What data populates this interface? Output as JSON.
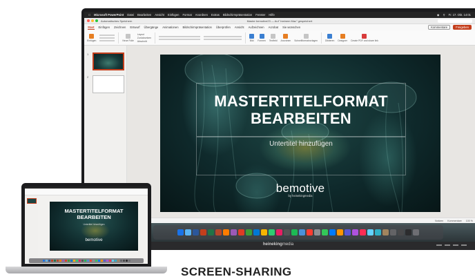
{
  "menubar": {
    "app": "Microsoft PowerPoint",
    "items": [
      "Datei",
      "Bearbeiten",
      "Ansicht",
      "Einfügen",
      "Format",
      "Anordnen",
      "Extras",
      "Bildschirmpräsentation",
      "Fenster",
      "Hilfe"
    ],
    "clock": "Fr. 17. Okt. 14:01"
  },
  "titlebar": {
    "autosave": "Automatisches Speichern",
    "document": "Master bemotive23 — Auf \"meinem Mac\" gespeichert"
  },
  "ribbon": {
    "tabs": [
      "Start",
      "Einfügen",
      "Zeichnen",
      "Entwurf",
      "Übergänge",
      "Animationen",
      "Bildschirmpräsentation",
      "Überprüfen",
      "Ansicht",
      "Aufzeichnen",
      "Acrobat",
      "Sie wünschen"
    ],
    "active_tab": "Start",
    "comments_label": "Kommentare",
    "share_label": "Freigeben",
    "groups": [
      "Einfügen",
      "Neue Folie",
      "Layout",
      "Zurücksetzen",
      "Abschnitt",
      "Bild",
      "Formen",
      "Textfeld",
      "Anordnen",
      "Schnellformatvorlagen",
      "Diktieren",
      "Designer",
      "Create PDF and share link"
    ]
  },
  "thumbnails": {
    "numbers": [
      "1",
      "2"
    ]
  },
  "slide": {
    "title_line1": "MASTERTITELFORMAT",
    "title_line2": "BEARBEITEN",
    "subtitle": "Untertitel hinzufügen",
    "logo_word": "bemotive",
    "logo_tag": "by heinekingmedia"
  },
  "statusbar": {
    "left": "Folienmaster  Untertitel",
    "notes": "Notizen",
    "comments": "Kommentare",
    "zoom": "100 %"
  },
  "monitor": {
    "brand_bold": "heineking",
    "brand_light": "media"
  },
  "dock_colors": [
    "#1a73e8",
    "#5ab4f5",
    "#2b579a",
    "#c43e1c",
    "#217346",
    "#b7472a",
    "#ff7c00",
    "#9b59b6",
    "#e03b24",
    "#3f9c35",
    "#0078d4",
    "#f7b500",
    "#2ecc71",
    "#e91e63",
    "#555555",
    "#1db954",
    "#4a90d9",
    "#ff3b30",
    "#8e8e93",
    "#34c759",
    "#007aff",
    "#ff9500",
    "#5856d6",
    "#af52de",
    "#ff2d55",
    "#64d2ff",
    "#30b0c7",
    "#a2845e",
    "#636366",
    "#48484a",
    "#2c2c2e",
    "#6e6e73"
  ],
  "caption": "SCREEN-SHARING"
}
